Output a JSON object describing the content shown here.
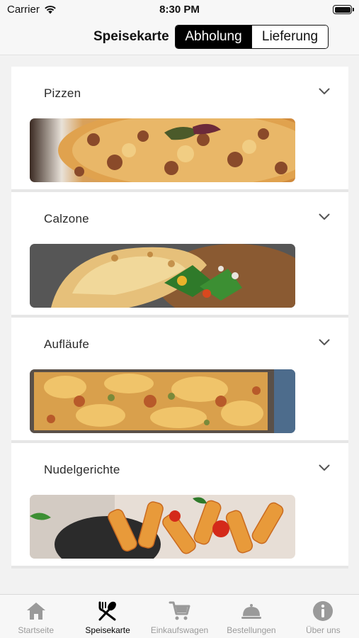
{
  "status_bar": {
    "carrier": "Carrier",
    "time": "8:30 PM",
    "icons": [
      "wifi-icon",
      "battery-icon"
    ]
  },
  "nav": {
    "title": "Speisekarte",
    "segments": [
      {
        "label": "Abholung",
        "selected": true
      },
      {
        "label": "Lieferung",
        "selected": false
      }
    ]
  },
  "categories": [
    {
      "name": "Pizzen",
      "icon": "chevron-down-icon",
      "image": "pizza-photo"
    },
    {
      "name": "Calzone",
      "icon": "chevron-down-icon",
      "image": "calzone-photo"
    },
    {
      "name": "Aufläufe",
      "icon": "chevron-down-icon",
      "image": "casserole-photo"
    },
    {
      "name": "Nudelgerichte",
      "icon": "chevron-down-icon",
      "image": "pasta-photo"
    }
  ],
  "tab_bar": {
    "tabs": [
      {
        "label": "Startseite",
        "icon": "home-icon",
        "active": false
      },
      {
        "label": "Speisekarte",
        "icon": "utensils-icon",
        "active": true
      },
      {
        "label": "Einkaufswagen",
        "icon": "cart-icon",
        "active": false
      },
      {
        "label": "Bestellungen",
        "icon": "cloche-icon",
        "active": false
      },
      {
        "label": "Über uns",
        "icon": "info-icon",
        "active": false
      }
    ]
  },
  "colors": {
    "background": "#f2f2f2",
    "card": "#ffffff",
    "active": "#000000",
    "inactive": "#9a9a9a"
  }
}
